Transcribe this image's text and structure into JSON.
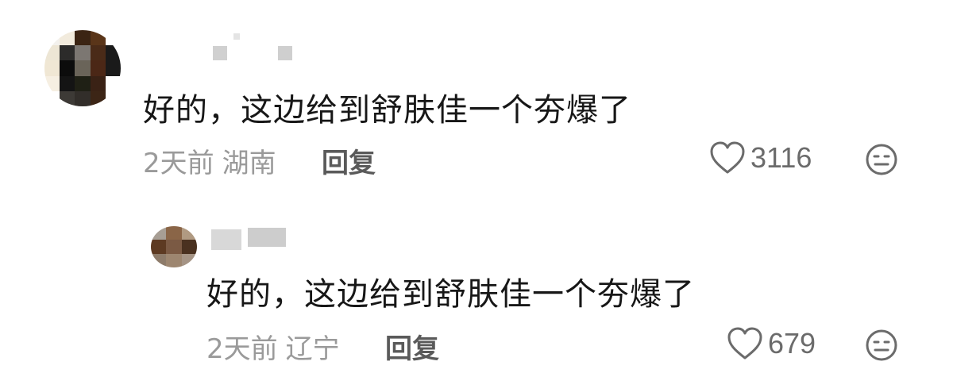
{
  "comments": [
    {
      "text": "好的，这边给到舒肤佳一个夯爆了",
      "time": "2天前",
      "location": "湖南",
      "reply_label": "回复",
      "likes": "3116",
      "avatar_colors": [
        "#f3f1ed",
        "#f2ebdd",
        "#3b2413",
        "#5a3519",
        "#ffffff",
        "#ede6d5",
        "#2c2b2a",
        "#7c7772",
        "#4a2b18",
        "#1a1a1a",
        "#f0e7d4",
        "#0c0c0c",
        "#6a6459",
        "#4b2716",
        "#1a1a1a",
        "#f6efe2",
        "#141414",
        "#1f2015",
        "#3a2215",
        "#ffffff",
        "#ffffff",
        "#3d3a36",
        "#322e2a",
        "#3c2516",
        "#ffffff"
      ]
    },
    {
      "text": "好的，这边给到舒肤佳一个夯爆了",
      "time": "2天前",
      "location": "辽宁",
      "reply_label": "回复",
      "likes": "679",
      "avatar_colors": [
        "#a79e94",
        "#8a6547",
        "#b09a82",
        "#5d3a22",
        "#7b5a44",
        "#4a3120",
        "#8d7b6a",
        "#9d8670",
        "#a59485"
      ]
    }
  ],
  "icons": {
    "like": "heart-outline-icon",
    "dislike": "meh-face-icon"
  }
}
